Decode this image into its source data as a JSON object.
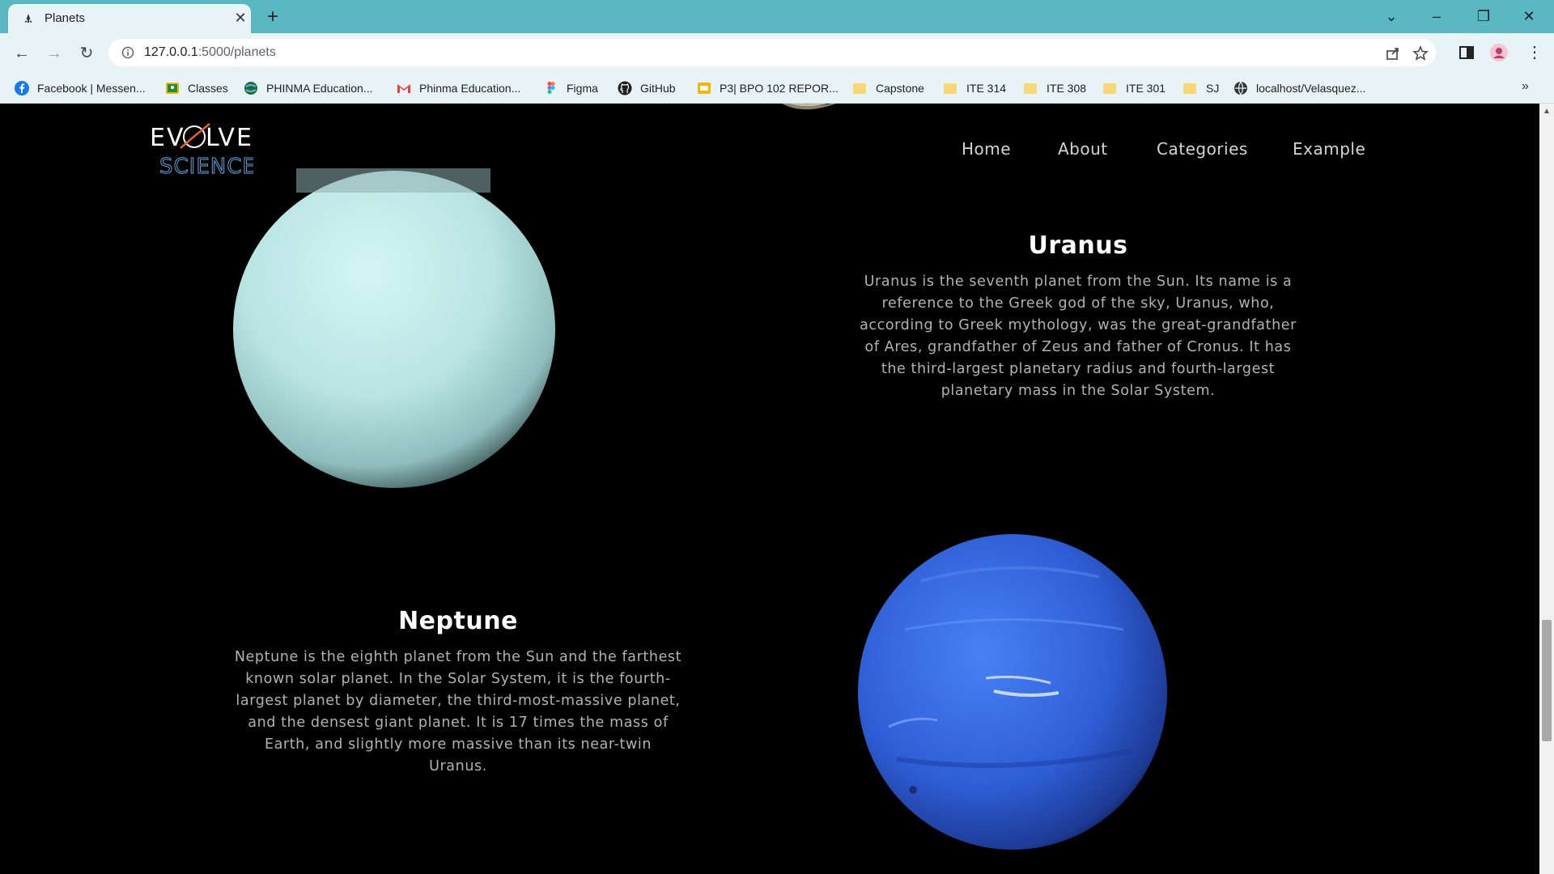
{
  "browser": {
    "tab_title": "Planets",
    "url_host": "127.0.0.1",
    "url_path": ":5000/planets",
    "bookmarks": [
      {
        "label": "Facebook | Messen...",
        "icon": "facebook-icon"
      },
      {
        "label": "Classes",
        "icon": "classroom-icon"
      },
      {
        "label": "PHINMA Education...",
        "icon": "globe-icon"
      },
      {
        "label": "Phinma Education...",
        "icon": "gmail-icon"
      },
      {
        "label": "Figma",
        "icon": "figma-icon"
      },
      {
        "label": "GitHub",
        "icon": "github-icon"
      },
      {
        "label": "P3| BPO 102 REPOR...",
        "icon": "slides-icon"
      },
      {
        "label": "Capstone",
        "icon": "folder-icon"
      },
      {
        "label": "ITE 314",
        "icon": "folder-icon"
      },
      {
        "label": "ITE 308",
        "icon": "folder-icon"
      },
      {
        "label": "ITE 301",
        "icon": "folder-icon"
      },
      {
        "label": "SJ",
        "icon": "folder-icon"
      },
      {
        "label": "localhost/Velasquez...",
        "icon": "globe-icon"
      }
    ],
    "more_bookmarks": "»"
  },
  "site": {
    "logo_alt": "EVOLVE SCIENCE",
    "nav": {
      "home": "Home",
      "about": "About",
      "categories": "Categories",
      "example": "Example"
    }
  },
  "planets": {
    "uranus": {
      "name": "Uranus",
      "description": "Uranus is the seventh planet from the Sun. Its name is a reference to the Greek god of the sky, Uranus, who, according to Greek mythology, was the great-grandfather of Ares, grandfather of Zeus and father of Cronus. It has the third-largest planetary radius and fourth-largest planetary mass in the Solar System.",
      "color": "#bfe6e6"
    },
    "neptune": {
      "name": "Neptune",
      "description": "Neptune is the eighth planet from the Sun and the farthest known solar planet. In the Solar System, it is the fourth-largest planet by diameter, the third-most-massive planet, and the densest giant planet. It is 17 times the mass of Earth, and slightly more massive than its near-twin Uranus.",
      "color": "#3a66e0"
    }
  }
}
